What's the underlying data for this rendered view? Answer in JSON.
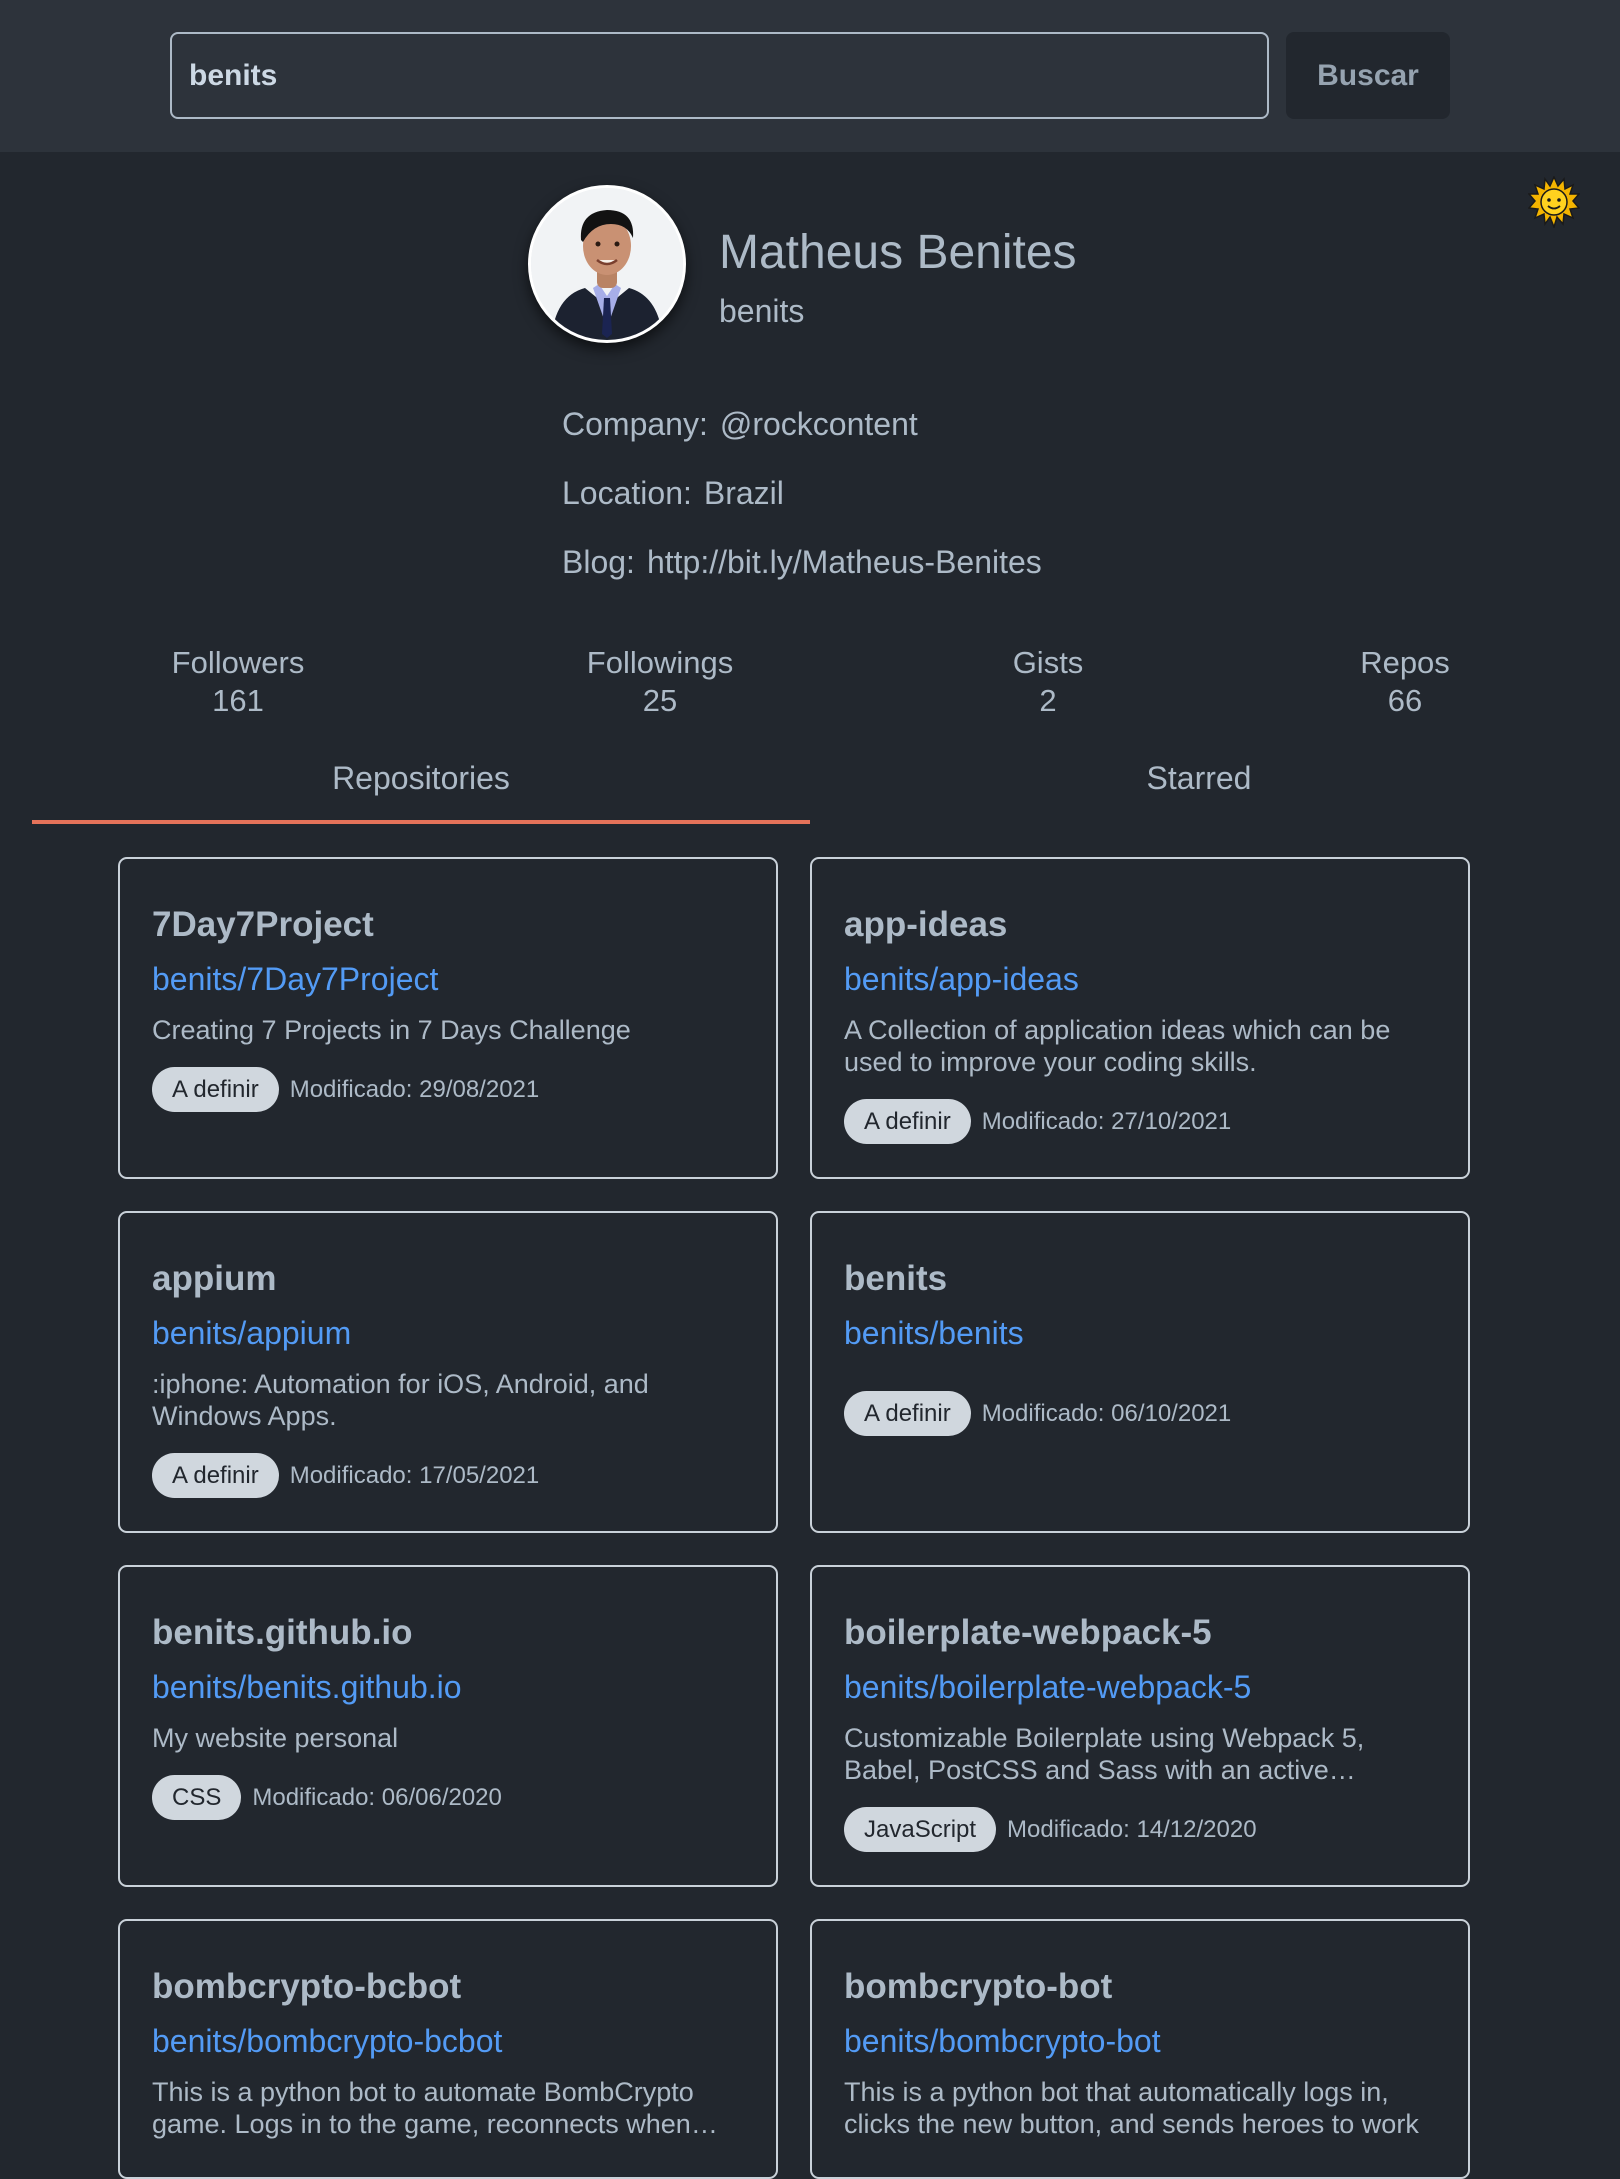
{
  "search": {
    "value": "benits",
    "button_label": "Buscar"
  },
  "theme_toggle": {
    "icon": "sun-icon",
    "glyph": "🌞"
  },
  "profile": {
    "name": "Matheus Benites",
    "login": "benits",
    "company_label": "Company:",
    "company": "@rockcontent",
    "location_label": "Location:",
    "location": "Brazil",
    "blog_label": "Blog:",
    "blog": "http://bit.ly/Matheus-Benites"
  },
  "stats": {
    "followers_label": "Followers",
    "followers": "161",
    "followings_label": "Followings",
    "followings": "25",
    "gists_label": "Gists",
    "gists": "2",
    "repos_label": "Repos",
    "repos": "66"
  },
  "tabs": {
    "repositories": "Repositories",
    "starred": "Starred",
    "active": "repositories"
  },
  "colors": {
    "background": "#22272e",
    "header": "#2d333b",
    "link": "#539bf5",
    "tab_indicator": "#e5735a",
    "badge": "#d0d7de"
  },
  "repos": [
    {
      "title": "7Day7Project",
      "full_name": "benits/7Day7Project",
      "description": "Creating 7 Projects in 7 Days Challenge",
      "language": "A definir",
      "modified": "Modificado: 29/08/2021"
    },
    {
      "title": "app-ideas",
      "full_name": "benits/app-ideas",
      "description": "A Collection of application ideas which can be used to improve your coding skills.",
      "language": "A definir",
      "modified": "Modificado: 27/10/2021"
    },
    {
      "title": "appium",
      "full_name": "benits/appium",
      "description": ":iphone: Automation for iOS, Android, and Windows Apps.",
      "language": "A definir",
      "modified": "Modificado: 17/05/2021"
    },
    {
      "title": "benits",
      "full_name": "benits/benits",
      "description": "",
      "language": "A definir",
      "modified": "Modificado: 06/10/2021"
    },
    {
      "title": "benits.github.io",
      "full_name": "benits/benits.github.io",
      "description": "My website personal",
      "language": "CSS",
      "modified": "Modificado: 06/06/2020"
    },
    {
      "title": "boilerplate-webpack-5",
      "full_name": "benits/boilerplate-webpack-5",
      "description": "Customizable Boilerplate using Webpack 5, Babel, PostCSS and Sass with an active community",
      "language": "JavaScript",
      "modified": "Modificado: 14/12/2020"
    },
    {
      "title": "bombcrypto-bcbot",
      "full_name": "benits/bombcrypto-bcbot",
      "description": "This is a python bot to automate BombCrypto game. Logs in to the game, reconnects when disconnected",
      "language": "",
      "modified": ""
    },
    {
      "title": "bombcrypto-bot",
      "full_name": "benits/bombcrypto-bot",
      "description": "This is a python bot that automatically logs in, clicks the new button, and sends heroes to work",
      "language": "",
      "modified": ""
    }
  ]
}
